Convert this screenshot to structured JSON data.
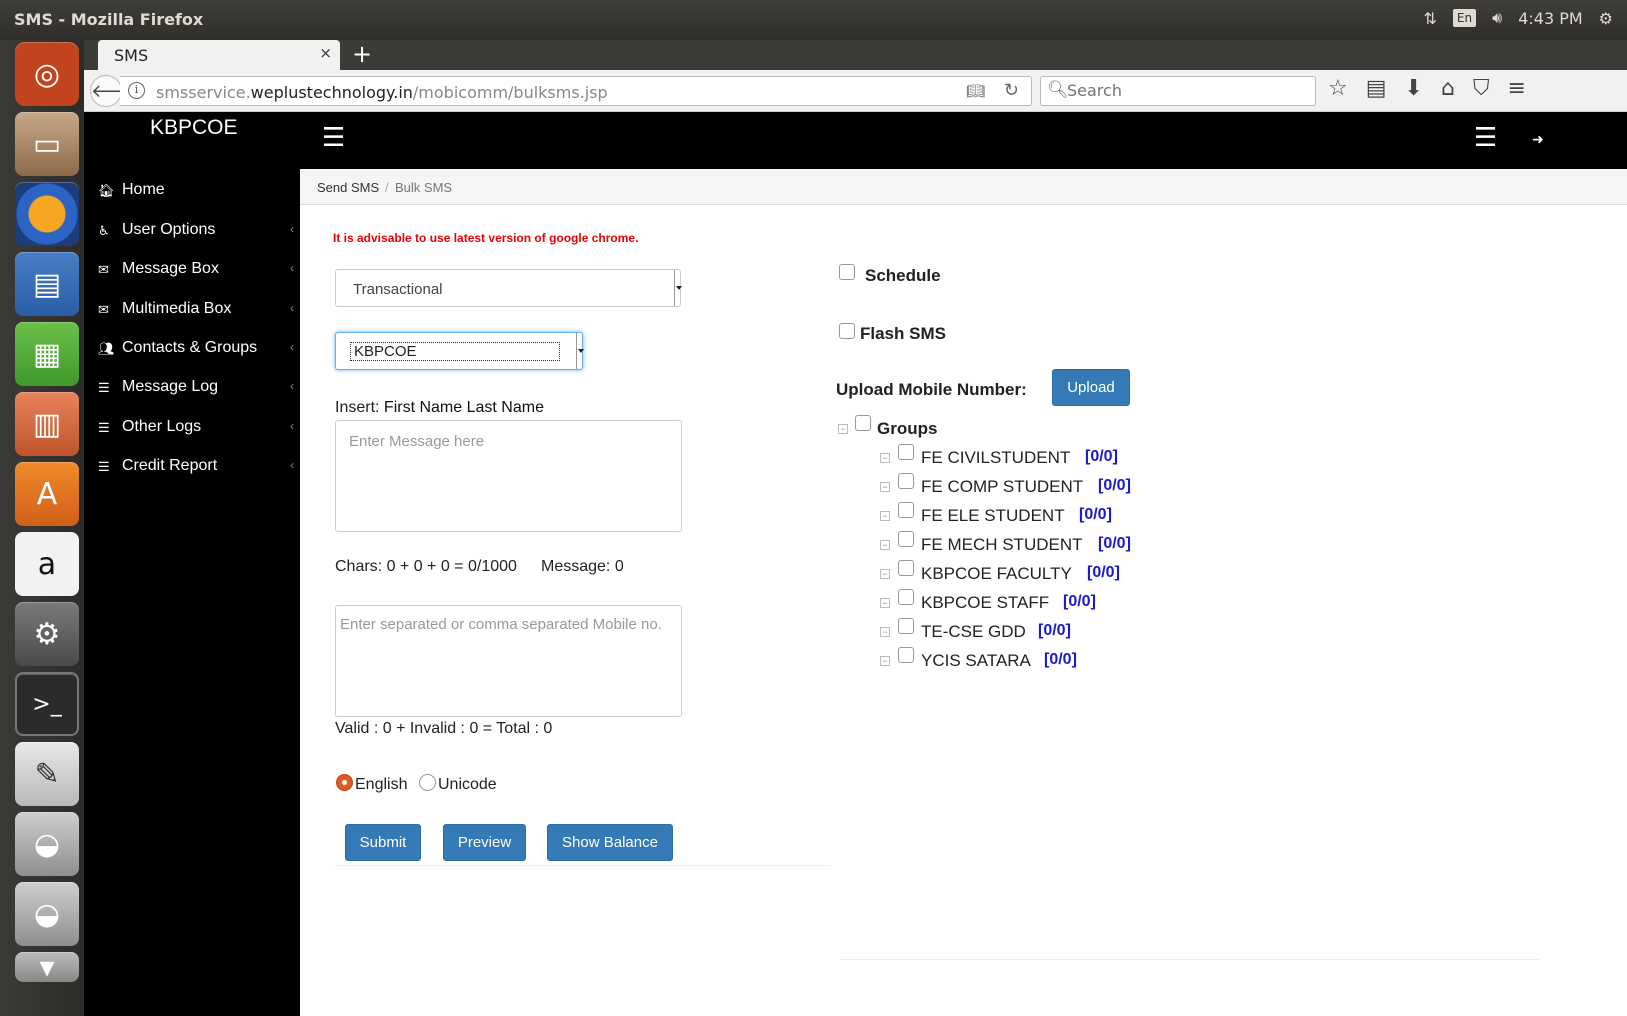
{
  "window": {
    "title": "SMS - Mozilla Firefox",
    "tray": {
      "lang": "En",
      "time": "4:43 PM"
    }
  },
  "launcher": [
    "ubuntu-dash-icon",
    "files-icon",
    "firefox-icon",
    "impress-icon",
    "calc-icon",
    "writer-icon",
    "software-center-icon",
    "amazon-icon",
    "system-settings-icon",
    "terminal-icon",
    "text-editor-icon",
    "drive-icon",
    "drive-icon",
    "trash-icon"
  ],
  "browser": {
    "tab_title": "SMS",
    "tab_close": "×",
    "new_tab": "+",
    "url_host_prefix": "smsservice.",
    "url_domain": "weplustechnology.in",
    "url_path": "/mobicomm/bulksms.jsp",
    "search_placeholder": "Search"
  },
  "app": {
    "brand": "KBPCOE",
    "menu_icon": "☰"
  },
  "sidebar": {
    "items": [
      {
        "label": "Home",
        "icon": "🏠︎"
      },
      {
        "label": "User Options",
        "icon": "♿︎"
      },
      {
        "label": "Message Box",
        "icon": "✉︎"
      },
      {
        "label": "Multimedia Box",
        "icon": "✉︎"
      },
      {
        "label": "Contacts & Groups",
        "icon": "👥︎"
      },
      {
        "label": "Message Log",
        "icon": "☰"
      },
      {
        "label": "Other Logs",
        "icon": "☰"
      },
      {
        "label": "Credit Report",
        "icon": "☰"
      }
    ],
    "arrow": "‹"
  },
  "breadcrumb": {
    "item1": "Send SMS",
    "sep": "/",
    "item2": "Bulk SMS"
  },
  "form": {
    "warning": "It is advisable to use latest version of google chrome.",
    "route": "Transactional",
    "sender": "KBPCOE",
    "insert_label": "Insert:",
    "insert_fields": "First Name Last Name",
    "message_placeholder": "Enter Message here",
    "chars": "Chars: 0 + 0 + 0 = 0/1000",
    "message_count": "Message: 0",
    "mobile_placeholder": "Enter separated or comma separated Mobile no.",
    "validity": "Valid : 0 + Invalid : 0 = Total : 0",
    "lang_english": "English",
    "lang_unicode": "Unicode",
    "submit": "Submit",
    "preview": "Preview",
    "show_balance": "Show Balance"
  },
  "options": {
    "schedule": "Schedule",
    "flash": "Flash SMS",
    "upload_label": "Upload Mobile Number:",
    "upload_button": "Upload",
    "groups_label": "Groups",
    "groups": [
      {
        "name": "FE CIVILSTUDENT",
        "count": "[0/0]"
      },
      {
        "name": "FE COMP STUDENT",
        "count": "[0/0]"
      },
      {
        "name": "FE ELE STUDENT",
        "count": "[0/0]"
      },
      {
        "name": "FE MECH STUDENT",
        "count": "[0/0]"
      },
      {
        "name": "KBPCOE FACULTY",
        "count": "[0/0]"
      },
      {
        "name": "KBPCOE STAFF",
        "count": "[0/0]"
      },
      {
        "name": "TE-CSE GDD",
        "count": "[0/0]"
      },
      {
        "name": "YCIS SATARA",
        "count": "[0/0]"
      }
    ]
  }
}
